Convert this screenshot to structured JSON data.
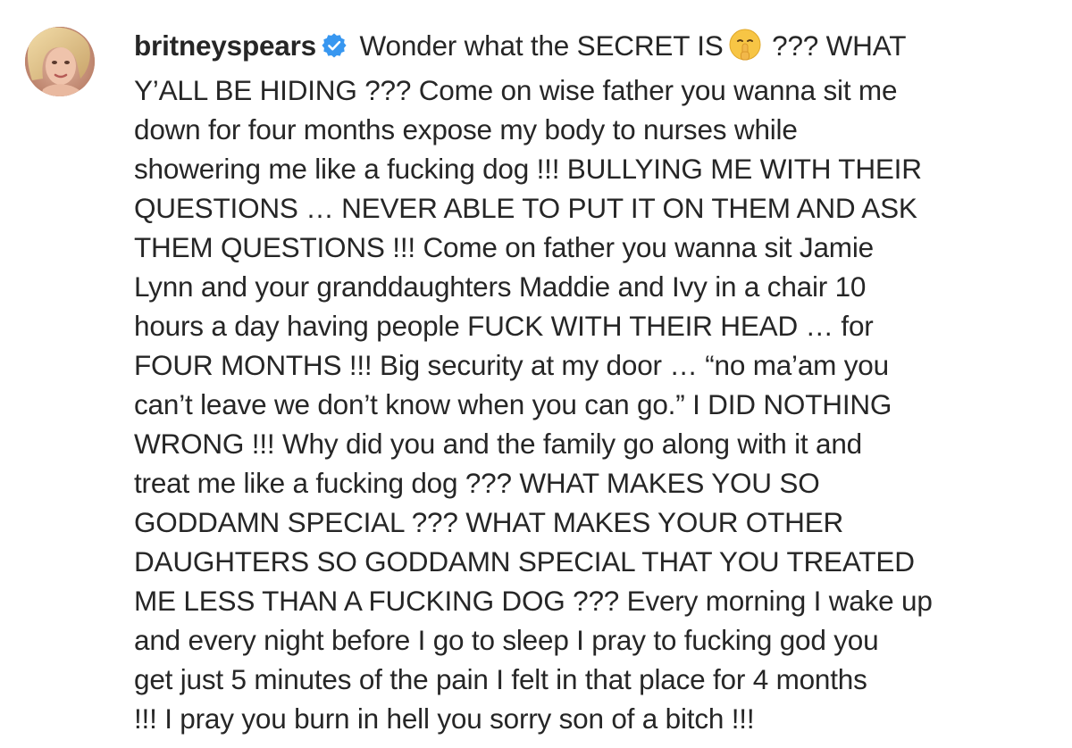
{
  "post": {
    "username": "britneyspears",
    "verified": true,
    "emoji": "shushing-face-emoji",
    "colors": {
      "text": "#262626",
      "verified_badge": "#3897f0",
      "background": "#ffffff"
    },
    "caption": {
      "line1_before_emoji": " Wonder what the SECRET IS",
      "line1_after_emoji": " ??? WHAT",
      "lines": [
        "Y’ALL BE HIDING ??? Come on wise father you wanna sit me",
        "down for four months expose my body to nurses while",
        "showering me like a fucking dog !!! BULLYING ME WITH THEIR",
        "QUESTIONS … NEVER ABLE TO PUT IT ON THEM AND ASK",
        "THEM QUESTIONS !!! Come on father you wanna sit Jamie",
        "Lynn and your granddaughters Maddie and Ivy in a chair 10",
        "hours a day having people FUCK WITH THEIR HEAD … for",
        "FOUR MONTHS !!! Big security at my door … “no ma’am you",
        "can’t leave we don’t know when you can go.” I DID NOTHING",
        "WRONG !!! Why did you and the family go along with it and",
        "treat me like a fucking dog ??? WHAT MAKES YOU SO",
        "GODDAMN SPECIAL ??? WHAT MAKES YOUR OTHER",
        "DAUGHTERS SO GODDAMN SPECIAL THAT YOU TREATED",
        "ME LESS THAN A FUCKING DOG ??? Every morning I wake up",
        "and every night before I go to sleep I pray to fucking god you",
        "get just 5 minutes of the pain I felt in that place for 4 months",
        "!!! I pray you burn in hell you sorry son of a bitch !!!"
      ]
    }
  }
}
